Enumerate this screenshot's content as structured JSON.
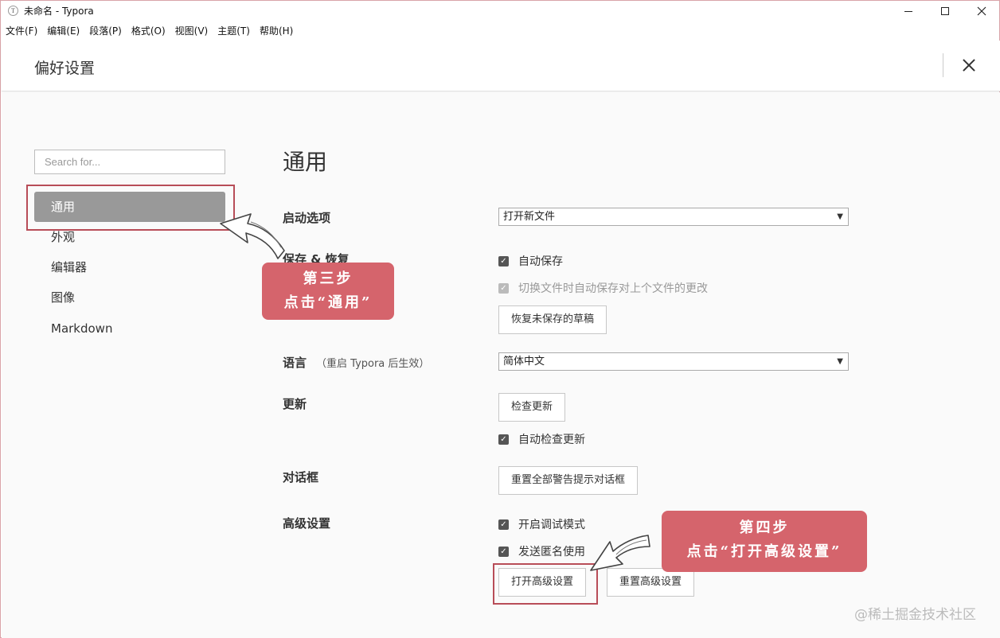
{
  "window": {
    "icon_letter": "T",
    "title": "未命名 - Typora"
  },
  "menu": [
    "文件(F)",
    "编辑(E)",
    "段落(P)",
    "格式(O)",
    "视图(V)",
    "主题(T)",
    "帮助(H)"
  ],
  "dialog": {
    "title": "偏好设置"
  },
  "sidebar": {
    "search_placeholder": "Search for...",
    "items": [
      "通用",
      "外观",
      "编辑器",
      "图像",
      "Markdown"
    ],
    "active_index": 0
  },
  "main": {
    "section_title": "通用",
    "startup": {
      "label": "启动选项",
      "value": "打开新文件"
    },
    "save": {
      "label": "保存 & 恢复",
      "autosave": "自动保存",
      "autosave_on_switch": "切换文件时自动保存对上个文件的更改",
      "recover_button": "恢复未保存的草稿"
    },
    "language": {
      "label": "语言",
      "note": "（重启 Typora 后生效）",
      "value": "简体中文"
    },
    "update": {
      "label": "更新",
      "check_button": "检查更新",
      "auto_check": "自动检查更新"
    },
    "dialogs": {
      "label": "对话框",
      "reset_button": "重置全部警告提示对话框"
    },
    "advanced": {
      "label": "高级设置",
      "debug_mode": "开启调试模式",
      "send_anonymous": "发送匿名使用",
      "open_button": "打开高级设置",
      "reset_button": "重置高级设置"
    }
  },
  "annotations": {
    "step3_line1": "第三步",
    "step3_line2": "点击“通用”",
    "step4_line1": "第四步",
    "step4_line2": "点击“打开高级设置”",
    "highlight_color": "#b84d58",
    "callout_color": "#d5646c"
  },
  "watermark": "@稀土掘金技术社区"
}
